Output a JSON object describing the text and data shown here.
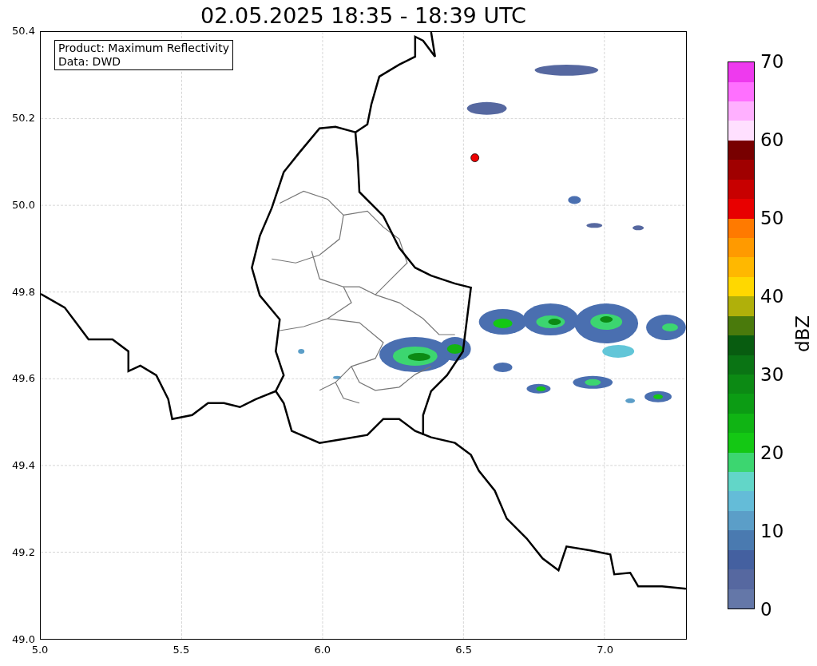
{
  "title": "02.05.2025 18:35 - 18:39 UTC",
  "legend": [
    "Product: Maximum Reflectivity",
    "Data: DWD"
  ],
  "y_ticks": [
    "50.4",
    "50.2",
    "50.0",
    "49.8",
    "49.6",
    "49.4",
    "49.2",
    "49.0"
  ],
  "x_ticks": [
    "5.0",
    "5.5",
    "6.0",
    "6.5",
    "7.0"
  ],
  "colorbar": {
    "label": "dBZ",
    "ticks": [
      "70",
      "60",
      "50",
      "40",
      "30",
      "20",
      "10",
      "0"
    ],
    "segments": [
      {
        "color": "#6477a8"
      },
      {
        "color": "#5668a0"
      },
      {
        "color": "#4460a0"
      },
      {
        "color": "#4a7ab0"
      },
      {
        "color": "#5b9ec8"
      },
      {
        "color": "#64bcd8"
      },
      {
        "color": "#62d6c8"
      },
      {
        "color": "#3cd670"
      },
      {
        "color": "#14c814"
      },
      {
        "color": "#10b414"
      },
      {
        "color": "#0c9c14"
      },
      {
        "color": "#0c8a14"
      },
      {
        "color": "#0a7414"
      },
      {
        "color": "#085c10"
      },
      {
        "color": "#4a7a0c"
      },
      {
        "color": "#b0b00a"
      },
      {
        "color": "#ffd800"
      },
      {
        "color": "#ffb800"
      },
      {
        "color": "#ff9a00"
      },
      {
        "color": "#ff7a00"
      },
      {
        "color": "#e80000"
      },
      {
        "color": "#c80000"
      },
      {
        "color": "#a00000"
      },
      {
        "color": "#780000"
      },
      {
        "color": "#ffe0ff"
      },
      {
        "color": "#ffb0ff"
      },
      {
        "color": "#ff70ff"
      },
      {
        "color": "#ee3aee"
      }
    ]
  }
}
